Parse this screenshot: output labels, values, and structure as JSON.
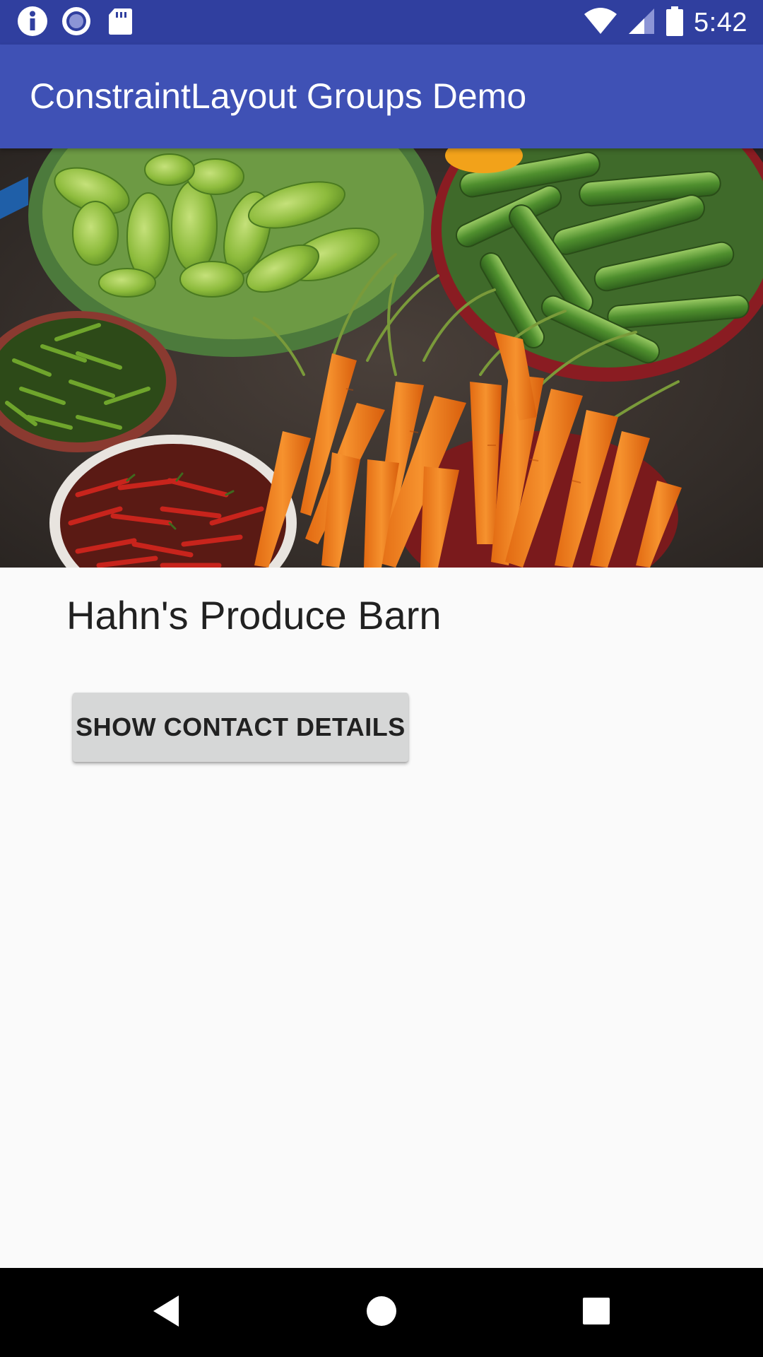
{
  "status_bar": {
    "time": "5:42",
    "left_icons": [
      "info-icon",
      "record-icon",
      "sd-card-icon"
    ],
    "right_icons": [
      "wifi-icon",
      "signal-icon",
      "battery-icon"
    ]
  },
  "app_bar": {
    "title": "ConstraintLayout Groups Demo"
  },
  "hero": {
    "subject": "vegetable-market-photo"
  },
  "content": {
    "store_name": "Hahn's Produce Barn",
    "contact_button_label": "SHOW CONTACT DETAILS"
  },
  "nav_bar": {
    "buttons": [
      "back-icon",
      "home-icon",
      "recents-icon"
    ]
  },
  "colors": {
    "status_bar": "#303f9f",
    "app_bar": "#3f51b5",
    "background": "#fafafa",
    "button": "#d6d7d7",
    "text_primary": "#212121",
    "nav_bar": "#000000"
  }
}
